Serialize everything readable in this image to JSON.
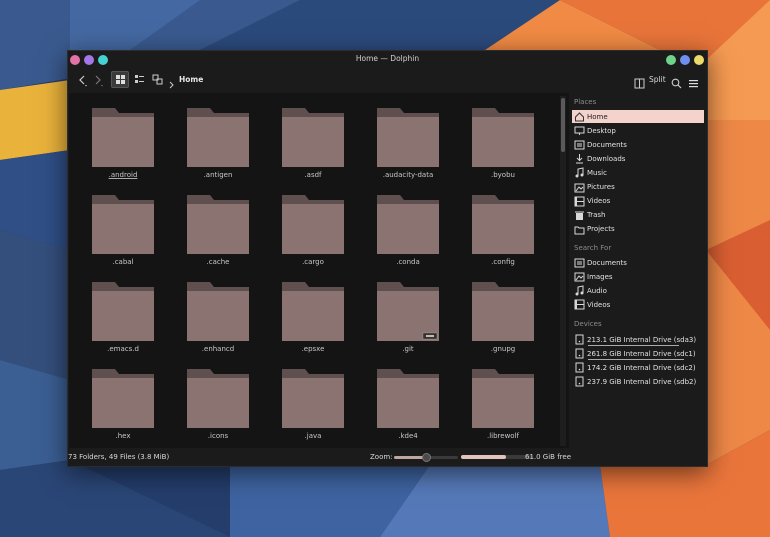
{
  "window": {
    "title": "Home — Dolphin",
    "left_buttons": [
      {
        "name": "close",
        "color": "#e472a6"
      },
      {
        "name": "minimize",
        "color": "#a476e8"
      },
      {
        "name": "maximize",
        "color": "#44d2d2"
      }
    ],
    "right_buttons": [
      {
        "name": "green",
        "color": "#6fd28a"
      },
      {
        "name": "blue",
        "color": "#6e8ff0"
      },
      {
        "name": "yellow",
        "color": "#ecdb6a"
      }
    ]
  },
  "toolbar": {
    "breadcrumb_home": "Home",
    "split_label": "Split",
    "icons": [
      "back-icon",
      "forward-icon",
      "icon-view-icon",
      "details-view-icon",
      "preview-icon",
      "chevron-right-icon",
      "split-icon",
      "search-icon",
      "hamburger-menu-icon"
    ]
  },
  "folders": [
    ".android",
    ".antigen",
    ".asdf",
    ".audacity-data",
    ".byobu",
    ".cabal",
    ".cache",
    ".cargo",
    ".conda",
    ".config",
    ".emacs.d",
    ".enhancd",
    ".epsxe",
    ".git",
    ".gnupg",
    ".hex",
    ".icons",
    ".java",
    ".kde4",
    ".librewolf"
  ],
  "folder_colors": {
    "body": "#8b7372",
    "tab": "#5f4f4f"
  },
  "panel": {
    "places_header": "Places",
    "places": [
      {
        "label": "Home",
        "icon": "home-icon",
        "selected": true
      },
      {
        "label": "Desktop",
        "icon": "desktop-icon"
      },
      {
        "label": "Documents",
        "icon": "documents-icon"
      },
      {
        "label": "Downloads",
        "icon": "downloads-icon"
      },
      {
        "label": "Music",
        "icon": "music-icon"
      },
      {
        "label": "Pictures",
        "icon": "pictures-icon"
      },
      {
        "label": "Videos",
        "icon": "videos-icon"
      },
      {
        "label": "Trash",
        "icon": "trash-icon"
      },
      {
        "label": "Projects",
        "icon": "projects-icon"
      }
    ],
    "search_header": "Search For",
    "search": [
      {
        "label": "Documents",
        "icon": "documents-icon"
      },
      {
        "label": "Images",
        "icon": "images-icon"
      },
      {
        "label": "Audio",
        "icon": "audio-icon"
      },
      {
        "label": "Videos",
        "icon": "videos-icon"
      }
    ],
    "devices_header": "Devices",
    "devices": [
      {
        "label": "213.1 GiB Internal Drive (sda3)",
        "icon": "drive-icon",
        "usage": 0.95
      },
      {
        "label": "261.8 GiB Internal Drive (sdc1)",
        "icon": "drive-icon",
        "usage": 1.0
      },
      {
        "label": "174.2 GiB Internal Drive (sdc2)",
        "icon": "drive-icon",
        "usage": 0
      },
      {
        "label": "237.9 GiB Internal Drive (sdb2)",
        "icon": "drive-icon",
        "usage": 0
      }
    ],
    "accent": "#f3d3cc"
  },
  "status": {
    "summary": "73 Folders, 49 Files (3.8 MiB)",
    "zoom_label": "Zoom:",
    "zoom_level": 0.5,
    "free_space": "61.0 GiB free",
    "used_fraction": 0.62
  }
}
